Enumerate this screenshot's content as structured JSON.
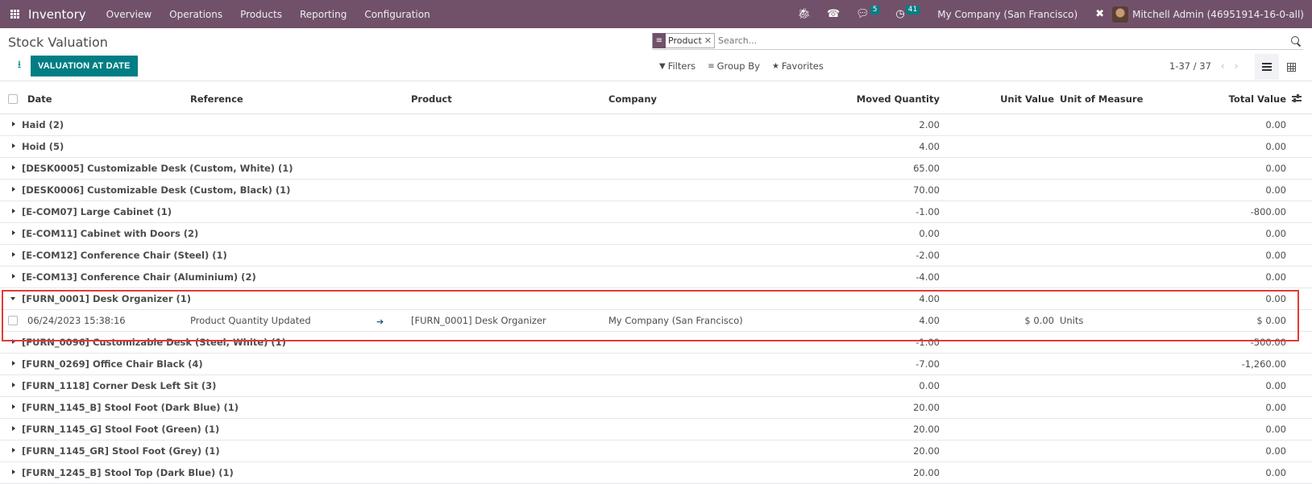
{
  "navbar": {
    "app_name": "Inventory",
    "menu": [
      "Overview",
      "Operations",
      "Products",
      "Reporting",
      "Configuration"
    ],
    "icons": [
      "bug-icon",
      "phone-icon",
      "chat-icon",
      "clock-icon"
    ],
    "messages_count": "5",
    "activities_count": "41",
    "company": "My Company (San Francisco)",
    "user": "Mitchell Admin (46951914-16-0-all)"
  },
  "control_panel": {
    "title": "Stock Valuation",
    "valuation_button": "VALUATION AT DATE",
    "search": {
      "facet_value": "Product",
      "placeholder": "Search..."
    },
    "filters_label": "Filters",
    "group_by_label": "Group By",
    "favorites_label": "Favorites",
    "pager": "1-37 / 37"
  },
  "table": {
    "columns": [
      "Date",
      "Reference",
      "Product",
      "Company",
      "Moved Quantity",
      "Unit Value",
      "Unit of Measure",
      "Total Value"
    ],
    "groups": [
      {
        "label": "Haid (2)",
        "moved_qty": "2.00",
        "total": "0.00"
      },
      {
        "label": "Hoid (5)",
        "moved_qty": "4.00",
        "total": "0.00"
      },
      {
        "label": "[DESK0005] Customizable Desk (Custom, White) (1)",
        "moved_qty": "65.00",
        "total": "0.00"
      },
      {
        "label": "[DESK0006] Customizable Desk (Custom, Black) (1)",
        "moved_qty": "70.00",
        "total": "0.00"
      },
      {
        "label": "[E-COM07] Large Cabinet (1)",
        "moved_qty": "-1.00",
        "total": "-800.00"
      },
      {
        "label": "[E-COM11] Cabinet with Doors (2)",
        "moved_qty": "0.00",
        "total": "0.00"
      },
      {
        "label": "[E-COM12] Conference Chair (Steel) (1)",
        "moved_qty": "-2.00",
        "total": "0.00"
      },
      {
        "label": "[E-COM13] Conference Chair (Aluminium) (2)",
        "moved_qty": "-4.00",
        "total": "0.00"
      },
      {
        "label": "[FURN_0001] Desk Organizer (1)",
        "moved_qty": "4.00",
        "total": "0.00",
        "expanded": true
      },
      {
        "label": "[FURN_0096] Customizable Desk (Steel, White) (1)",
        "moved_qty": "-1.00",
        "total": "-500.00"
      },
      {
        "label": "[FURN_0269] Office Chair Black (4)",
        "moved_qty": "-7.00",
        "total": "-1,260.00"
      },
      {
        "label": "[FURN_1118] Corner Desk Left Sit (3)",
        "moved_qty": "0.00",
        "total": "0.00"
      },
      {
        "label": "[FURN_1145_B] Stool Foot (Dark Blue) (1)",
        "moved_qty": "20.00",
        "total": "0.00"
      },
      {
        "label": "[FURN_1145_G] Stool Foot (Green) (1)",
        "moved_qty": "20.00",
        "total": "0.00"
      },
      {
        "label": "[FURN_1145_GR] Stool Foot (Grey) (1)",
        "moved_qty": "20.00",
        "total": "0.00"
      },
      {
        "label": "[FURN_1245_B] Stool Top (Dark Blue) (1)",
        "moved_qty": "20.00",
        "total": "0.00"
      }
    ],
    "detail_row": {
      "date": "06/24/2023 15:38:16",
      "reference": "Product Quantity Updated",
      "product": "[FURN_0001] Desk Organizer",
      "company": "My Company (San Francisco)",
      "moved_qty": "4.00",
      "unit_value": "$ 0.00",
      "uom": "Units",
      "total": "$ 0.00"
    }
  },
  "colors": {
    "navbar": "#71516a",
    "primary": "#017e84",
    "highlight": "#e53935"
  }
}
